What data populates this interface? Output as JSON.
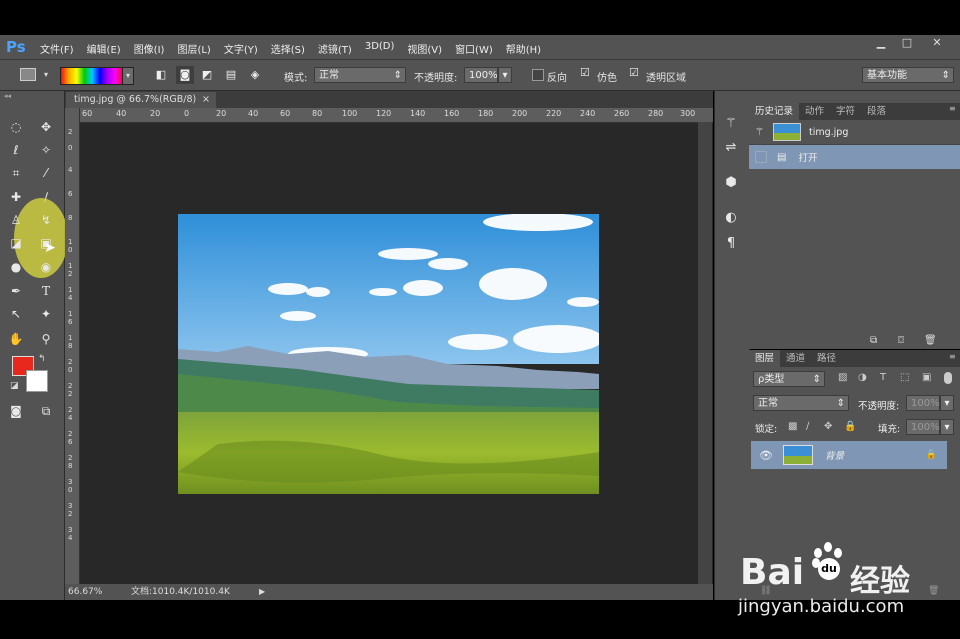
{
  "app": {
    "logo": "Ps"
  },
  "menu": [
    "文件(F)",
    "编辑(E)",
    "图像(I)",
    "图层(L)",
    "文字(Y)",
    "选择(S)",
    "滤镜(T)",
    "3D(D)",
    "视图(V)",
    "窗口(W)",
    "帮助(H)"
  ],
  "window_controls": [
    "▁",
    "□",
    "✕"
  ],
  "options": {
    "mode_label": "模式:",
    "mode_value": "正常",
    "opacity_label": "不透明度:",
    "opacity_value": "100%",
    "reverse_label": "反向",
    "dither_label": "仿色",
    "transparency_label": "透明区域",
    "workspace": "基本功能"
  },
  "document": {
    "tab_title": "timg.jpg @ 66.7%(RGB/8)",
    "tab_close": "×",
    "zoom": "66.67%",
    "doc_info": "文档:1010.4K/1010.4K"
  },
  "ruler_h": [
    "60",
    "40",
    "20",
    "0",
    "20",
    "40",
    "60",
    "80",
    "100",
    "120",
    "140",
    "160",
    "180",
    "200",
    "220",
    "240",
    "260",
    "280",
    "300"
  ],
  "ruler_v": [
    "2",
    "0",
    "4",
    "6",
    "8",
    "1 0",
    "1 2",
    "1 4",
    "1 6",
    "1 8",
    "2 0",
    "2 2",
    "2 4",
    "2 6",
    "2 8",
    "3 0",
    "3 2",
    "3 4"
  ],
  "history_panel": {
    "tabs": [
      "历史记录",
      "动作",
      "字符",
      "段落"
    ],
    "snapshot_name": "timg.jpg",
    "steps": [
      "打开"
    ]
  },
  "layers_panel": {
    "tabs": [
      "图层",
      "通道",
      "路径"
    ],
    "filter_label": "ρ类型",
    "blend_mode": "正常",
    "opacity_label": "不透明度:",
    "opacity_value": "100%",
    "lock_label": "锁定:",
    "fill_label": "填充:",
    "fill_value": "100%",
    "layers": [
      {
        "name": "背景",
        "visible": true,
        "locked": true
      }
    ]
  },
  "watermark": {
    "brand": "Bai",
    "brand2": "经验",
    "url": "jingyan.baidu.com"
  },
  "colors": {
    "foreground": "#e8281c",
    "background": "#ffffff",
    "selection": "#7f97b5",
    "ui": "#535353"
  }
}
